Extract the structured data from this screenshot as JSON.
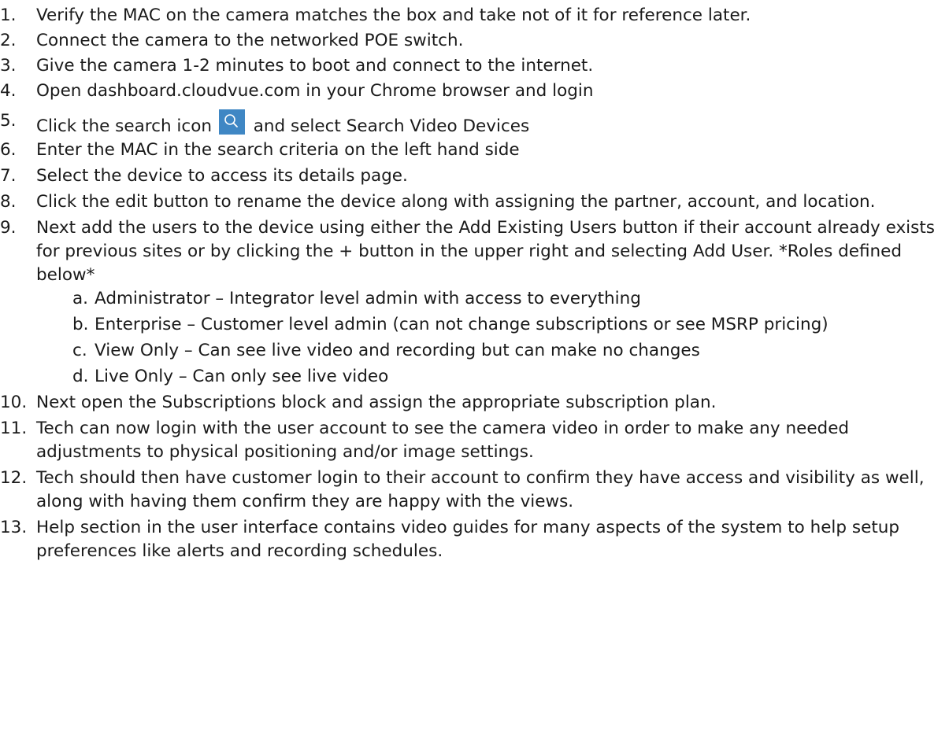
{
  "steps": [
    {
      "num": "1.",
      "text": "Verify the MAC on the camera matches the box and take not of it for reference later."
    },
    {
      "num": "2.",
      "text": "Connect the camera to the networked POE switch."
    },
    {
      "num": "3.",
      "text": "Give the camera 1-2 minutes to boot and connect to the internet."
    },
    {
      "num": "4.",
      "text": "Open dashboard.cloudvue.com in your Chrome browser and login"
    },
    {
      "num": "5.",
      "text_before": "Click the search icon",
      "text_after": "and select Search Video Devices",
      "icon": "search-icon"
    },
    {
      "num": "6.",
      "text": "Enter the MAC in the search criteria on the left hand side"
    },
    {
      "num": "7.",
      "text": "Select the device to access its details page."
    },
    {
      "num": "8.",
      "text": "Click the edit button to rename the device along with assigning the partner, account, and location."
    },
    {
      "num": "9.",
      "text": "Next add the users to the device using either the Add Existing Users button if their account already exists for previous sites or by clicking the + button in the upper right and selecting Add User. *Roles defined below*"
    },
    {
      "num": "10.",
      "text": "Next open the Subscriptions block and assign the appropriate subscription plan."
    },
    {
      "num": "11.",
      "text": "Tech can now login with the user account to see the camera video in order to make any needed adjustments to physical positioning and/or image settings."
    },
    {
      "num": "12.",
      "text": "Tech should then have customer login to their account to confirm they have access and visibility as well, along with having them confirm they are happy with the views."
    },
    {
      "num": "13.",
      "text": "Help section in the user interface contains video guides for many aspects of the system to help setup preferences like alerts and recording schedules."
    }
  ],
  "roles": [
    {
      "num": "a.",
      "text": "Administrator – Integrator level admin with access to everything"
    },
    {
      "num": "b.",
      "text": "Enterprise – Customer level admin (can not change subscriptions or see MSRP pricing)"
    },
    {
      "num": "c.",
      "text": "View Only – Can see live video and recording but can make no changes"
    },
    {
      "num": "d.",
      "text": "Live Only – Can only see live video"
    }
  ],
  "colors": {
    "search_icon_bg": "#3f87c4",
    "text": "#1a1a1a"
  }
}
